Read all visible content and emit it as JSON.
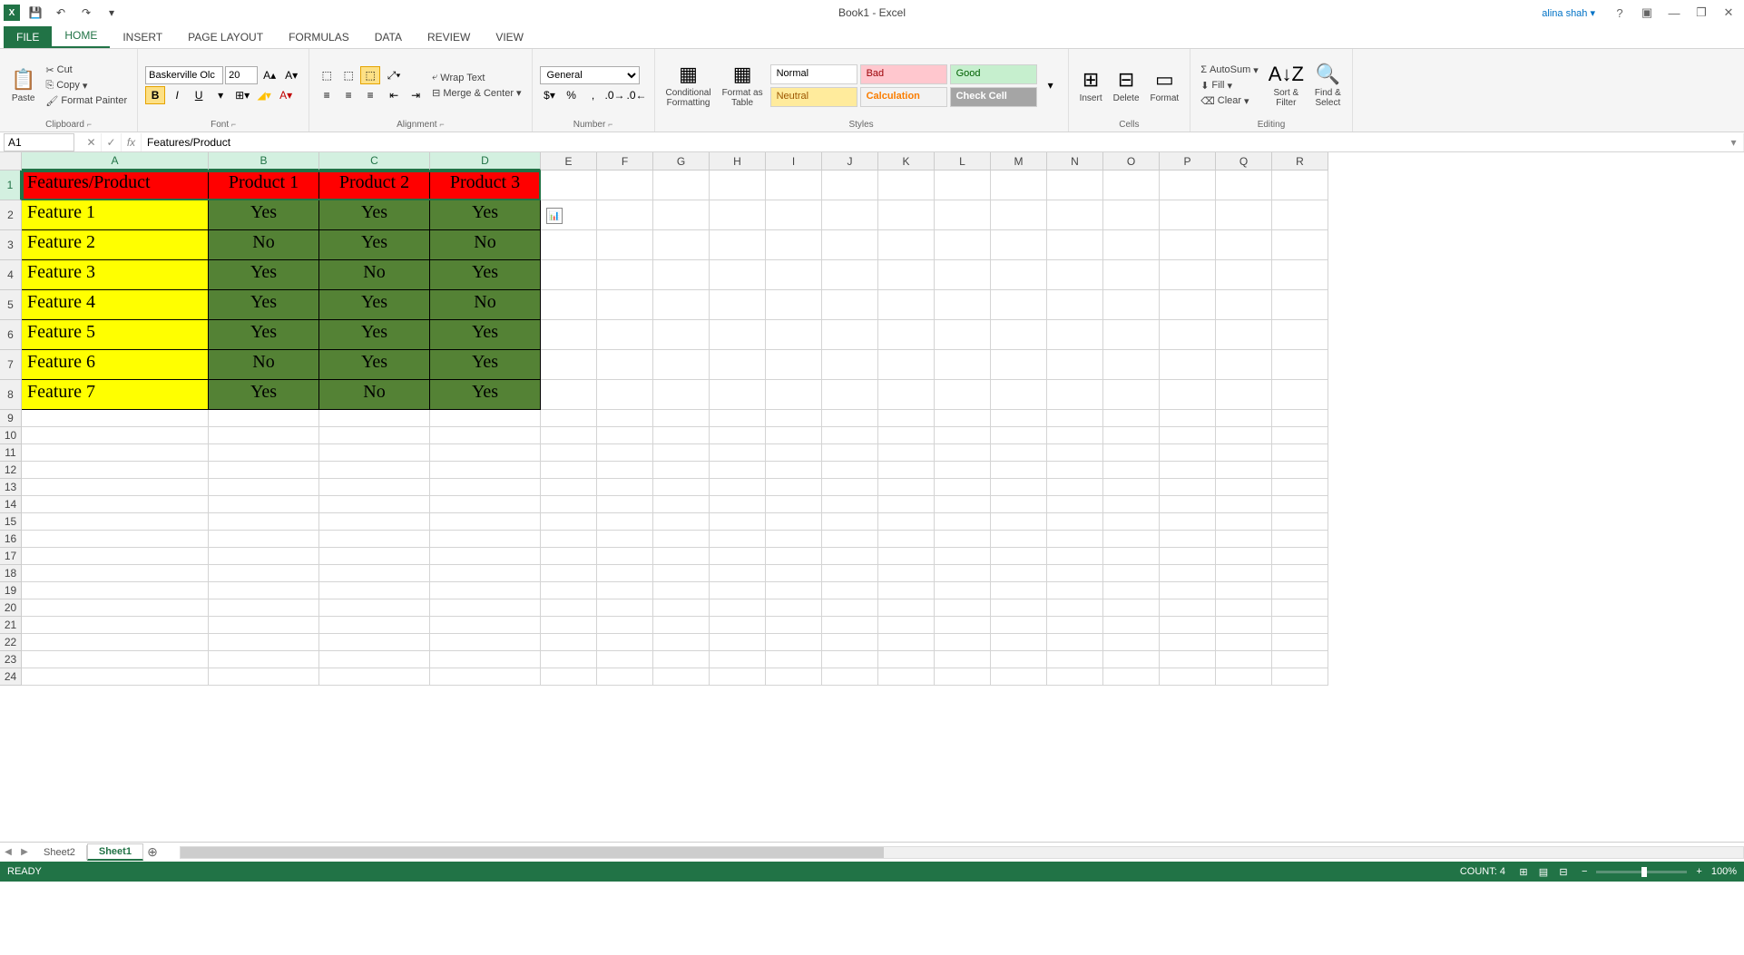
{
  "title": "Book1 - Excel",
  "user": "alina shah",
  "qat": {
    "save": "💾",
    "undo": "↶",
    "redo": "↷"
  },
  "tabs": {
    "file": "FILE",
    "items": [
      "HOME",
      "INSERT",
      "PAGE LAYOUT",
      "FORMULAS",
      "DATA",
      "REVIEW",
      "VIEW"
    ],
    "active": "HOME"
  },
  "ribbon": {
    "clipboard": {
      "label": "Clipboard",
      "paste": "Paste",
      "cut": "Cut",
      "copy": "Copy",
      "painter": "Format Painter"
    },
    "font": {
      "label": "Font",
      "name": "Baskerville Olc",
      "size": "20",
      "bold": "B",
      "italic": "I",
      "underline": "U"
    },
    "alignment": {
      "label": "Alignment",
      "wrap": "Wrap Text",
      "merge": "Merge & Center"
    },
    "number": {
      "label": "Number",
      "format": "General"
    },
    "styles": {
      "label": "Styles",
      "conditional": "Conditional\nFormatting",
      "table": "Format as\nTable",
      "normal": "Normal",
      "bad": "Bad",
      "good": "Good",
      "neutral": "Neutral",
      "calc": "Calculation",
      "check": "Check Cell"
    },
    "cells": {
      "label": "Cells",
      "insert": "Insert",
      "delete": "Delete",
      "format": "Format"
    },
    "editing": {
      "label": "Editing",
      "autosum": "AutoSum",
      "fill": "Fill",
      "clear": "Clear",
      "sort": "Sort &\nFilter",
      "find": "Find &\nSelect"
    }
  },
  "nameBox": "A1",
  "formulaBar": "Features/Product",
  "columns": [
    "A",
    "B",
    "C",
    "D",
    "E",
    "F",
    "G",
    "H",
    "I",
    "J",
    "K",
    "L",
    "M",
    "N",
    "O",
    "P",
    "Q",
    "R"
  ],
  "colWidths": {
    "A": 206,
    "B": 122,
    "C": 122,
    "D": 122,
    "default": 62
  },
  "rowHeights": {
    "data": 33,
    "default": 19
  },
  "selectedCols": [
    "A",
    "B",
    "C",
    "D"
  ],
  "selectedRow": 1,
  "gridData": {
    "headers": [
      "Features/Product",
      "Product 1",
      "Product 2",
      "Product 3"
    ],
    "rows": [
      [
        "Feature 1",
        "Yes",
        "Yes",
        "Yes"
      ],
      [
        "Feature 2",
        "No",
        "Yes",
        "No"
      ],
      [
        "Feature 3",
        "Yes",
        "No",
        "Yes"
      ],
      [
        "Feature 4",
        "Yes",
        "Yes",
        "No"
      ],
      [
        "Feature 5",
        "Yes",
        "Yes",
        "Yes"
      ],
      [
        "Feature 6",
        "No",
        "Yes",
        "Yes"
      ],
      [
        "Feature 7",
        "Yes",
        "No",
        "Yes"
      ]
    ]
  },
  "sheets": {
    "items": [
      "Sheet2",
      "Sheet1"
    ],
    "active": "Sheet1"
  },
  "status": {
    "ready": "READY",
    "count": "COUNT: 4",
    "zoom": "100%"
  }
}
